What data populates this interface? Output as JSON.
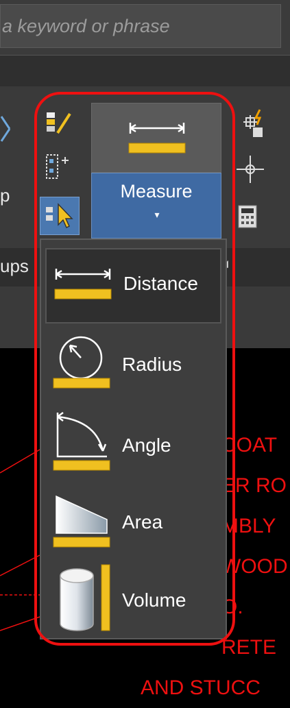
{
  "search": {
    "placeholder": "a keyword or phrase"
  },
  "ribbon": {
    "left_fragments": [
      "p",
      "ups"
    ],
    "measure": {
      "label": "Measure",
      "caret": "▾"
    },
    "panel_caret": "◢"
  },
  "measure_menu": {
    "items": [
      {
        "label": "Distance",
        "icon": "distance-icon",
        "active": true
      },
      {
        "label": "Radius",
        "icon": "radius-icon",
        "active": false
      },
      {
        "label": "Angle",
        "icon": "angle-icon",
        "active": false
      },
      {
        "label": "Area",
        "icon": "area-icon",
        "active": false
      },
      {
        "label": "Volume",
        "icon": "volume-icon",
        "active": false
      }
    ]
  },
  "drawing_text": [
    "COAT",
    "ER RO",
    "MBLY",
    "WOOD",
    "O.",
    "RETE",
    "AND STUCC"
  ],
  "colors": {
    "highlight": "#ee1010",
    "measure_blue": "#3f6aa3",
    "ruler_yellow": "#f0c020"
  }
}
